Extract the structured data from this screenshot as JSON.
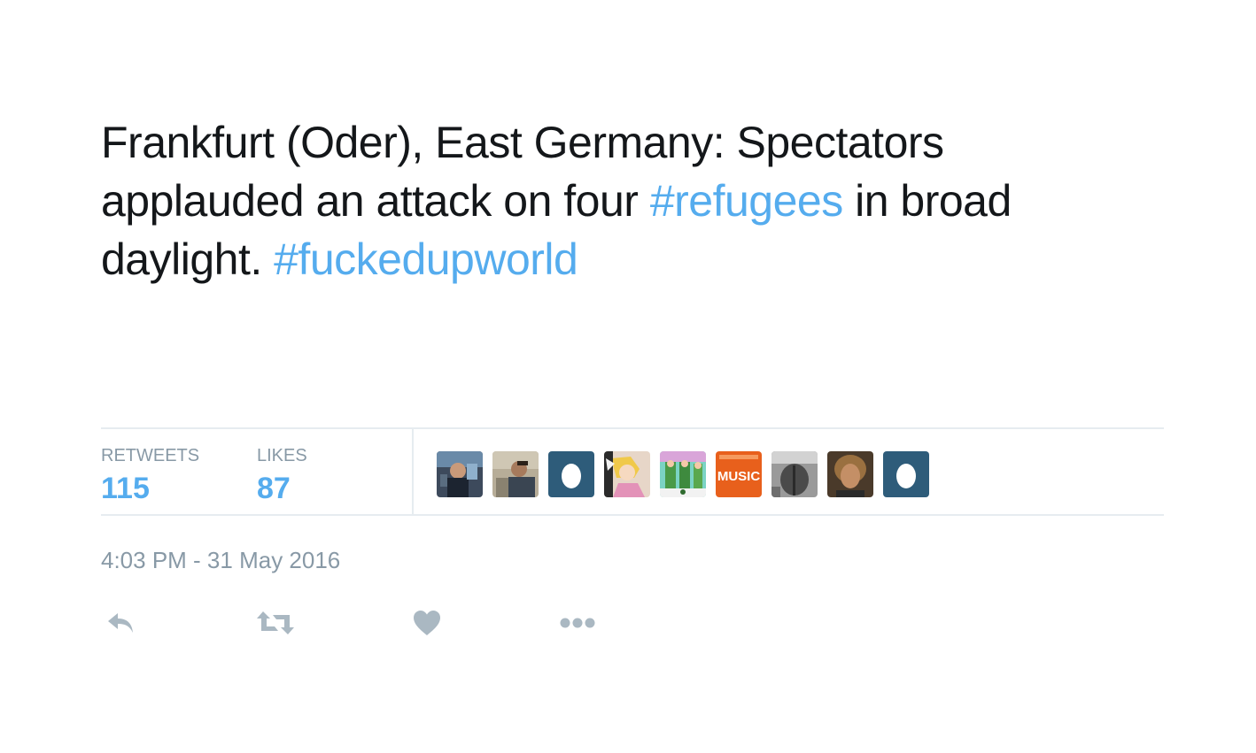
{
  "tweet": {
    "text_parts": [
      {
        "text": "Frankfurt (Oder), East Germany: Spectators applauded an attack on four ",
        "type": "text"
      },
      {
        "text": "#refugees",
        "type": "hashtag"
      },
      {
        "text": " in broad daylight. ",
        "type": "text"
      },
      {
        "text": "#fuckedupworld",
        "type": "hashtag"
      }
    ]
  },
  "stats": {
    "retweets_label": "RETWEETS",
    "retweets_count": "115",
    "likes_label": "LIKES",
    "likes_count": "87"
  },
  "likers": [
    {
      "name": "avatar-1",
      "style": "photo-dark"
    },
    {
      "name": "avatar-2",
      "style": "photo-person"
    },
    {
      "name": "avatar-3",
      "style": "egg"
    },
    {
      "name": "avatar-4",
      "style": "cartoon"
    },
    {
      "name": "avatar-5",
      "style": "green-art"
    },
    {
      "name": "avatar-6",
      "style": "music-logo",
      "label": "MUSIC"
    },
    {
      "name": "avatar-7",
      "style": "photo-gray"
    },
    {
      "name": "avatar-8",
      "style": "photo-face"
    },
    {
      "name": "avatar-9",
      "style": "egg"
    }
  ],
  "timestamp": "4:03 PM - 31 May 2016",
  "actions": {
    "reply_icon": "reply-icon",
    "retweet_icon": "retweet-icon",
    "like_icon": "heart-icon",
    "more_icon": "more-icon"
  },
  "colors": {
    "text": "#14171a",
    "link": "#55acee",
    "muted": "#8899a6",
    "icon": "#aab8c2",
    "egg_bg": "#2e5c7a",
    "music_bg": "#e8601c"
  }
}
